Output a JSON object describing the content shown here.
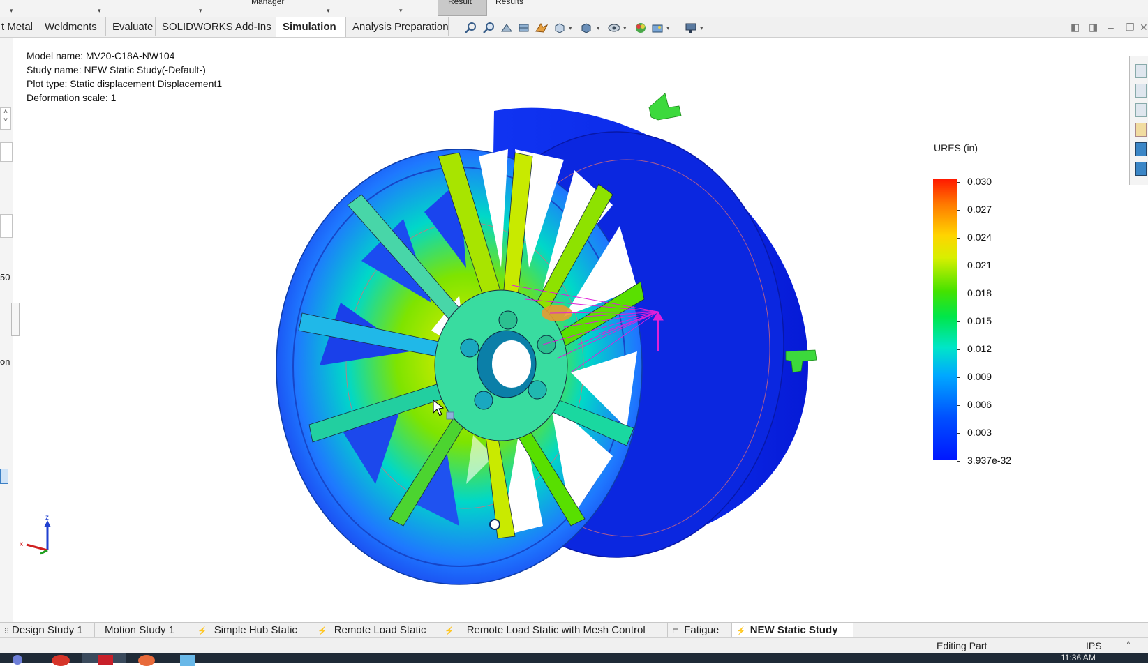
{
  "top_strip": {
    "manager": "Manager",
    "result": "Result",
    "results": "Results"
  },
  "tabs": [
    "t Metal",
    "Weldments",
    "Evaluate",
    "SOLIDWORKS Add-Ins",
    "Simulation",
    "Analysis Preparation"
  ],
  "active_tab": "Simulation",
  "left_panel_fragments": [
    "50",
    "on"
  ],
  "info": {
    "model_name": "Model name: MV20-C18A-NW104",
    "study_name": "Study name: NEW Static Study(-Default-)",
    "plot_type": "Plot type: Static displacement Displacement1",
    "deformation": "Deformation scale: 1"
  },
  "legend": {
    "title": "URES (in)",
    "labels": [
      "0.030",
      "0.027",
      "0.024",
      "0.021",
      "0.018",
      "0.015",
      "0.012",
      "0.009",
      "0.006",
      "0.003",
      "3.937e-32"
    ]
  },
  "triad": {
    "z": "z",
    "x": "x"
  },
  "bottom_tabs": [
    "Design Study 1",
    "Motion Study 1",
    "Simple Hub Static",
    "Remote Load Static",
    "Remote Load Static with Mesh Control",
    "Fatigue",
    "NEW Static Study"
  ],
  "status": {
    "mode": "Editing Part",
    "units": "IPS",
    "time": "11:36 AM"
  },
  "colors": {
    "accent_load": "#e020d8",
    "fixture": "#3cd93c",
    "rim_blue": "#1030e8"
  }
}
